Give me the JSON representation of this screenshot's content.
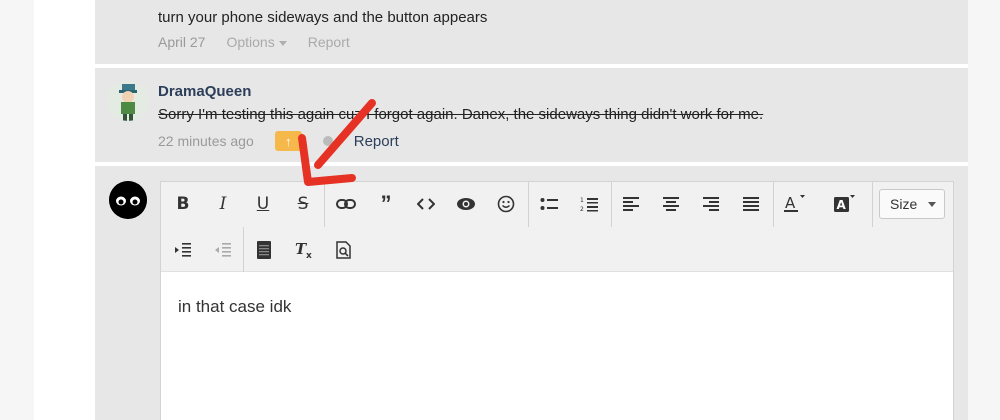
{
  "comment1": {
    "text": "turn your phone sideways and the button appears",
    "date": "April 27",
    "options_label": "Options",
    "report_label": "Report"
  },
  "comment2": {
    "author": "DramaQueen",
    "text": "Sorry I'm testing this again cuz I forgot again. Danex, the sideways thing didn't work for me.",
    "time": "22 minutes ago",
    "report_label": "Report"
  },
  "editor": {
    "size_label": "Size",
    "content": "in that case idk"
  },
  "colors": {
    "accent_vote": "#f6b84a",
    "annotation_arrow": "#e53224",
    "author_link": "#2c3e5a"
  }
}
